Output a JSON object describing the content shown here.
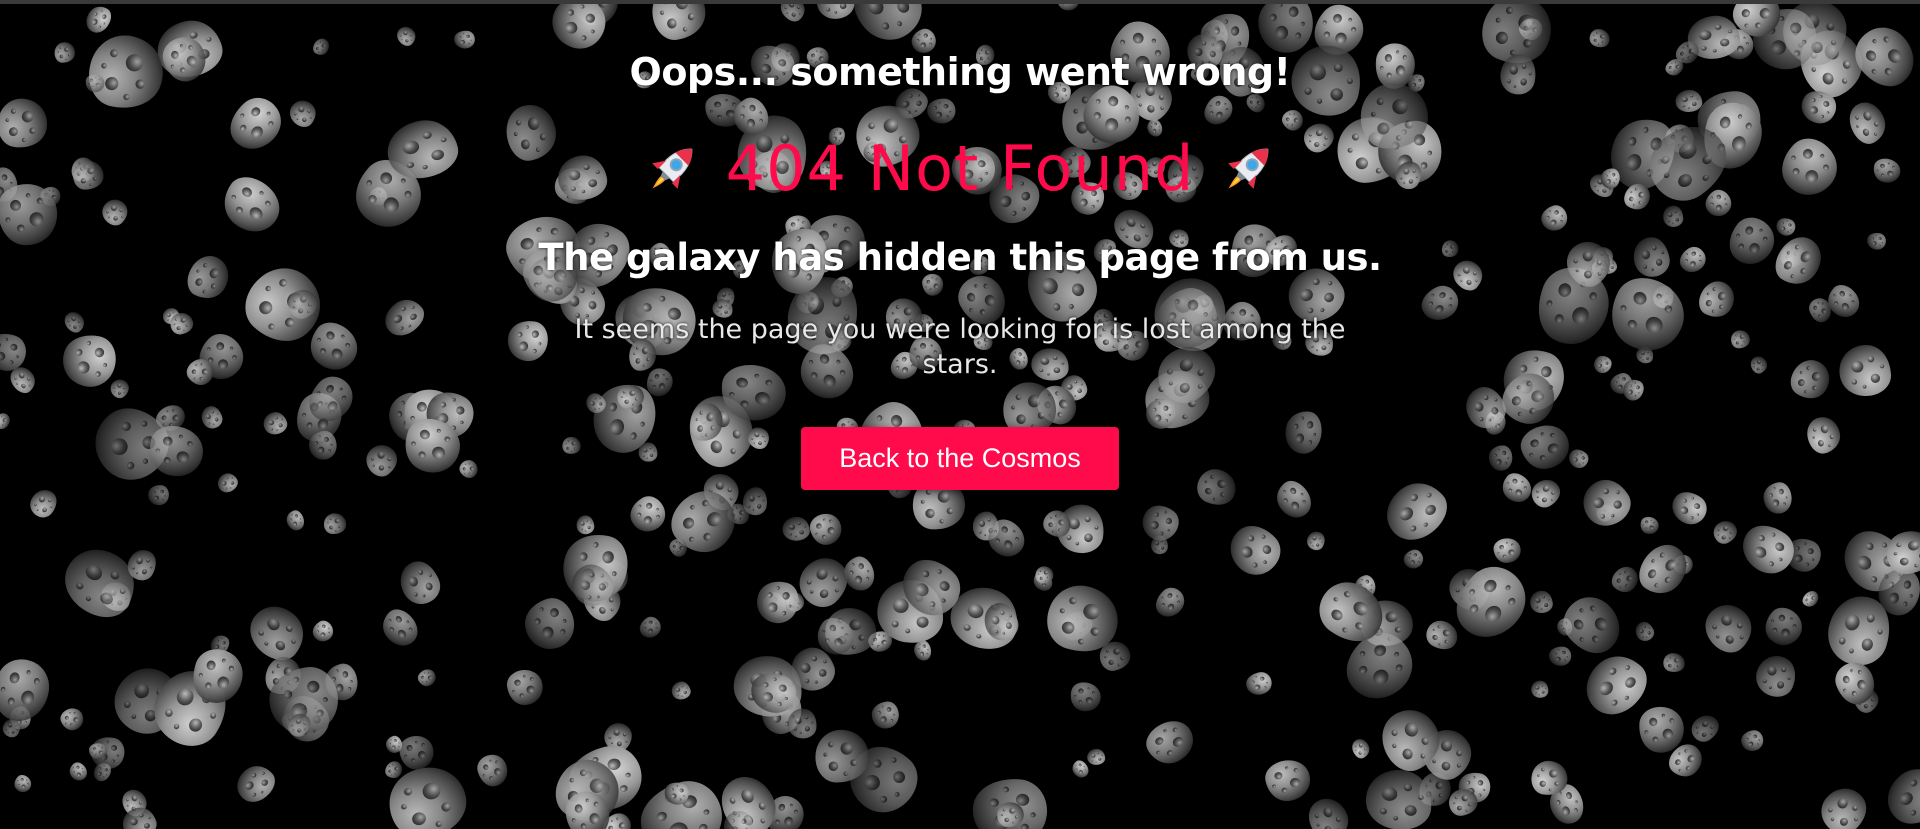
{
  "page": {
    "oops_text": "Oops... something went wrong!",
    "title": "404 Not Found",
    "subtitle": "The galaxy has hidden this page from us.",
    "description": "It seems the page you were looking for is lost among the stars.",
    "button_label": "Back to the Cosmos"
  },
  "icons": {
    "left": "rocket-icon",
    "right": "rocket-icon",
    "background": "asteroid"
  },
  "colors": {
    "accent": "#ff0a4b",
    "background": "#000000",
    "text": "#ffffff"
  }
}
